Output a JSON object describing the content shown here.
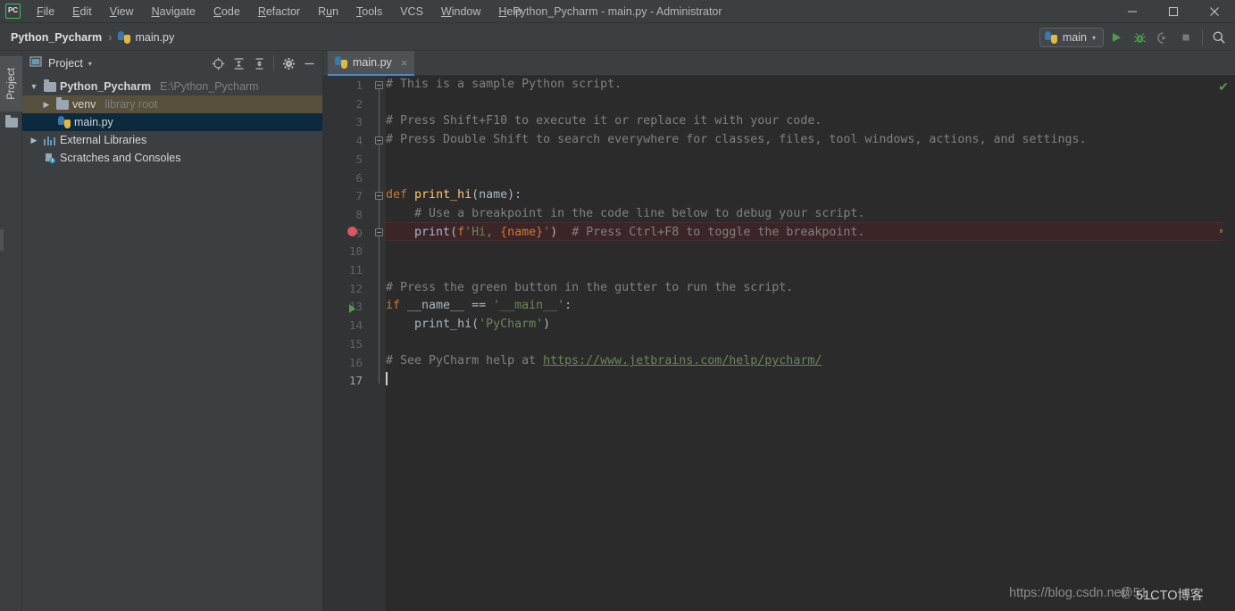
{
  "window": {
    "title": "Python_Pycharm - main.py - Administrator",
    "logo_text": "PC",
    "controls": {
      "minimize": "minimize-icon",
      "maximize": "maximize-icon",
      "close": "close-icon"
    }
  },
  "menubar": {
    "items": [
      {
        "label": "File",
        "mnemonic": "F"
      },
      {
        "label": "Edit",
        "mnemonic": "E"
      },
      {
        "label": "View",
        "mnemonic": "V"
      },
      {
        "label": "Navigate",
        "mnemonic": "N"
      },
      {
        "label": "Code",
        "mnemonic": "C"
      },
      {
        "label": "Refactor",
        "mnemonic": "R"
      },
      {
        "label": "Run",
        "mnemonic": "u"
      },
      {
        "label": "Tools",
        "mnemonic": "T"
      },
      {
        "label": "VCS",
        "mnemonic": ""
      },
      {
        "label": "Window",
        "mnemonic": "W"
      },
      {
        "label": "Help",
        "mnemonic": "H"
      }
    ]
  },
  "navbar": {
    "breadcrumb": [
      {
        "label": "Python_Pycharm",
        "icon": ""
      },
      {
        "label": "main.py",
        "icon": "python-file-icon"
      }
    ],
    "separator": "›",
    "run_config": {
      "label": "main",
      "icon": "python-icon",
      "caret": "▾"
    },
    "actions": [
      {
        "name": "run-button",
        "icon": "play-icon"
      },
      {
        "name": "debug-button",
        "icon": "bug-icon"
      },
      {
        "name": "run-with-coverage-button",
        "icon": "coverage-icon"
      },
      {
        "name": "stop-button",
        "icon": "stop-icon"
      },
      {
        "name": "search-everywhere-button",
        "icon": "search-icon"
      }
    ]
  },
  "left_stripe": {
    "tab_label": "Project",
    "folder_icon": "folder-icon"
  },
  "project_panel": {
    "title": "Project",
    "caret": "▾",
    "tools": [
      {
        "name": "select-opened-file-button",
        "icon": "target-icon"
      },
      {
        "name": "expand-all-button",
        "icon": "expand-all-icon"
      },
      {
        "name": "collapse-all-button",
        "icon": "collapse-all-icon"
      },
      {
        "name": "settings-button",
        "icon": "gear-icon"
      },
      {
        "name": "hide-button",
        "icon": "minus-icon"
      }
    ],
    "tree": [
      {
        "label": "Python_Pycharm",
        "meta": "E:\\Python_Pycharm",
        "icon": "folder-icon",
        "chevron": "⌄",
        "expanded": true,
        "indent": 0,
        "state": "none",
        "bold": true
      },
      {
        "label": "venv",
        "meta": "library root",
        "icon": "folder-icon",
        "chevron": "›",
        "expanded": false,
        "indent": 1,
        "state": "highlighted",
        "bold": false
      },
      {
        "label": "main.py",
        "meta": "",
        "icon": "python-file-icon",
        "chevron": "",
        "expanded": false,
        "indent": 2,
        "state": "selected",
        "bold": false
      },
      {
        "label": "External Libraries",
        "meta": "",
        "icon": "library-icon",
        "chevron": "›",
        "expanded": false,
        "indent": 0,
        "state": "none",
        "bold": false
      },
      {
        "label": "Scratches and Consoles",
        "meta": "",
        "icon": "scratches-icon",
        "chevron": "",
        "expanded": false,
        "indent": 0,
        "state": "none",
        "bold": false
      }
    ]
  },
  "editor": {
    "tab": {
      "label": "main.py",
      "icon": "python-file-icon",
      "close": "×"
    },
    "inspection_status": {
      "icon": "checkmark-icon",
      "color": "#4f9c4f"
    },
    "current_line": 17,
    "breakpoint_line": 9,
    "run_gutter_line": 13,
    "lines": [
      {
        "n": 1,
        "text": "# This is a sample Python script."
      },
      {
        "n": 2,
        "text": ""
      },
      {
        "n": 3,
        "text": "# Press Shift+F10 to execute it or replace it with your code."
      },
      {
        "n": 4,
        "text": "# Press Double Shift to search everywhere for classes, files, tool windows, actions, and settings."
      },
      {
        "n": 5,
        "text": ""
      },
      {
        "n": 6,
        "text": ""
      },
      {
        "n": 7,
        "text": "def print_hi(name):"
      },
      {
        "n": 8,
        "text": "    # Use a breakpoint in the code line below to debug your script."
      },
      {
        "n": 9,
        "text": "    print(f'Hi, {name}')  # Press Ctrl+F8 to toggle the breakpoint."
      },
      {
        "n": 10,
        "text": ""
      },
      {
        "n": 11,
        "text": ""
      },
      {
        "n": 12,
        "text": "# Press the green button in the gutter to run the script."
      },
      {
        "n": 13,
        "text": "if __name__ == '__main__':"
      },
      {
        "n": 14,
        "text": "    print_hi('PyCharm')"
      },
      {
        "n": 15,
        "text": ""
      },
      {
        "n": 16,
        "text": "# See PyCharm help at https://www.jetbrains.com/help/pycharm/"
      },
      {
        "n": 17,
        "text": ""
      }
    ],
    "tokens": {
      "l1": "# This is a sample Python script.",
      "l3": "# Press Shift+F10 to execute it or replace it with your code.",
      "l4": "# Press Double Shift to search everywhere for classes, files, tool windows, actions, and settings.",
      "l7_kw": "def",
      "l7_fn": "print_hi",
      "l7_rest": "(name):",
      "l8": "# Use a breakpoint in the code line below to debug your script.",
      "l9_call": "print",
      "l9_fp": "f",
      "l9_s1": "'Hi, ",
      "l9_interp": "{name}",
      "l9_s2": "'",
      "l9_close": ")",
      "l9_comment": "# Press Ctrl+F8 to toggle the breakpoint.",
      "l12": "# Press the green button in the gutter to run the script.",
      "l13_if": "if",
      "l13_name": " __name__ == ",
      "l13_str": "'__main__'",
      "l13_colon": ":",
      "l14_fn": "print_hi",
      "l14_open": "(",
      "l14_str": "'PyCharm'",
      "l14_close": ")",
      "l16_comment": "# See PyCharm help at ",
      "l16_url": "https://www.jetbrains.com/help/pycharm/"
    }
  },
  "watermarks": {
    "primary": "https://blog.csdn.net/",
    "overlay_a": "@51_",
    "overlay_b": "51CTO博客"
  },
  "colors": {
    "accent_blue": "#4a88c7",
    "selection_blue": "#0d293e",
    "highlight_tan": "#56503c",
    "breakpoint_red": "#db5860",
    "run_green": "#4f9c4f",
    "editor_bg": "#2b2b2b",
    "chrome_bg": "#3c3f41",
    "gutter_bg": "#313335"
  }
}
